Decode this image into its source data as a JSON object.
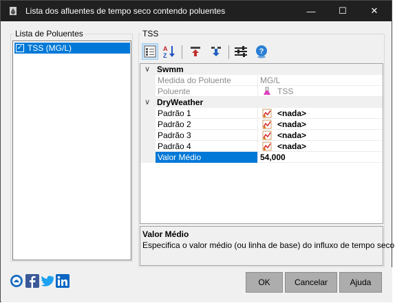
{
  "window": {
    "title": "Lista dos afluentes de tempo seco contendo poluentes",
    "minimize_glyph": "—",
    "maximize_glyph": "☐",
    "close_glyph": "✕"
  },
  "left_panel": {
    "group_label": "Lista de Poluentes",
    "items": [
      {
        "label": "TSS (MG/L)",
        "checked": true,
        "selected": true
      }
    ]
  },
  "right_panel": {
    "group_label": "TSS",
    "toolbar_icons": [
      "categorized-view-icon",
      "alphabetical-sort-icon",
      "move-up-icon",
      "move-down-icon",
      "settings-sliders-icon",
      "help-icon"
    ]
  },
  "grid": {
    "categories": [
      {
        "name": "Swmm",
        "rows": [
          {
            "name": "Medida do Poluente",
            "value": "MG/L",
            "disabled": true
          },
          {
            "name": "Poluente",
            "value": "TSS",
            "disabled": true,
            "icon": "flask-icon"
          }
        ]
      },
      {
        "name": "DryWeather",
        "rows": [
          {
            "name": "Padrão 1",
            "value": "<nada>",
            "icon": "pattern-icon"
          },
          {
            "name": "Padrão 2",
            "value": "<nada>",
            "icon": "pattern-icon"
          },
          {
            "name": "Padrão 3",
            "value": "<nada>",
            "icon": "pattern-icon"
          },
          {
            "name": "Padrão 4",
            "value": "<nada>",
            "icon": "pattern-icon"
          },
          {
            "name": "Valor Médio",
            "value": "54,000",
            "selected": true
          }
        ]
      }
    ]
  },
  "description": {
    "title": "Valor Médio",
    "text": "Especifica o valor médio (ou linha de base) do influxo de tempo seco"
  },
  "buttons": {
    "ok": "OK",
    "cancel": "Cancelar",
    "help": "Ajuda"
  },
  "colors": {
    "selection": "#0078d7",
    "titlebar": "#202020",
    "button_face": "#adadad"
  }
}
